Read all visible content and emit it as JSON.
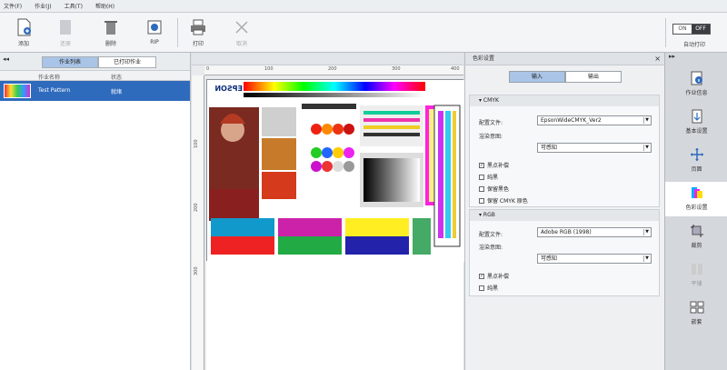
{
  "menu": [
    "文件(F)",
    "作业(J)",
    "工具(T)",
    "帮助(H)"
  ],
  "toolbar": {
    "add": "添加",
    "restore": "还原",
    "delete": "删除",
    "rip": "RIP",
    "print": "打印",
    "cancel": "取消",
    "toggle_on": "ON",
    "toggle_off": "OFF",
    "auto_print": "自动打印"
  },
  "left_panel": {
    "collapse": "◂◂",
    "tab_list": "作业列表",
    "tab_printed": "已打印作业",
    "col_name": "作业名称",
    "col_status": "状态",
    "job_name": "Test Pattern",
    "job_status": "就绪"
  },
  "preview": {
    "ruler_h": [
      "0",
      "100",
      "200",
      "300",
      "400"
    ],
    "ruler_v": [
      "100",
      "200",
      "300"
    ],
    "brand": "EPSON"
  },
  "color_settings": {
    "title": "色彩设置",
    "close": "×",
    "tab_input": "输入",
    "tab_output": "输出",
    "cmyk": {
      "header": "CMYK",
      "profile_label": "配置文件:",
      "profile_value": "EpsonWideCMYK_Ver2",
      "intent_label": "渲染意图:",
      "intent_value": "可感知",
      "checks": [
        {
          "label": "黑点补偿",
          "checked": true
        },
        {
          "label": "纯黑",
          "checked": false
        },
        {
          "label": "保留黑色",
          "checked": false
        },
        {
          "label": "保留 CMYK 原色",
          "checked": false
        }
      ]
    },
    "rgb": {
      "header": "RGB",
      "profile_label": "配置文件:",
      "profile_value": "Adobe RGB (1998)",
      "intent_label": "渲染意图:",
      "intent_value": "可感知",
      "checks": [
        {
          "label": "黑点补偿",
          "checked": true
        },
        {
          "label": "纯黑",
          "checked": false
        }
      ]
    }
  },
  "sidebar": [
    {
      "label": "作业信息",
      "icon": "info-icon"
    },
    {
      "label": "基本设置",
      "icon": "basic-settings-icon"
    },
    {
      "label": "页面",
      "icon": "layout-icon"
    },
    {
      "label": "色彩设置",
      "icon": "color-settings-icon"
    },
    {
      "label": "裁剪",
      "icon": "crop-icon"
    },
    {
      "label": "平铺",
      "icon": "tile-icon"
    },
    {
      "label": "嵌套",
      "icon": "nest-icon"
    }
  ]
}
